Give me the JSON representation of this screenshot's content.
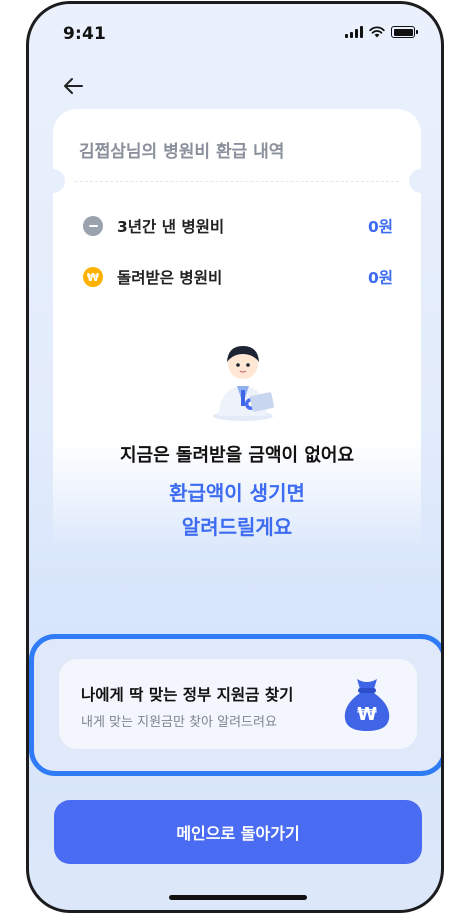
{
  "status_bar": {
    "time": "9:41"
  },
  "card": {
    "title": "김쩝삼님의 병원비 환급 내역",
    "rows": [
      {
        "label": "3년간 낸 병원비",
        "value": "0원",
        "icon": "minus-icon"
      },
      {
        "label": "돌려받은 병원비",
        "value": "0원",
        "icon": "won-coin-icon"
      }
    ],
    "empty_title": "지금은 돌려받을 금액이 없어요",
    "empty_sub_line1": "환급액이 생기면",
    "empty_sub_line2": "알려드릴게요"
  },
  "banner": {
    "title": "나에게 딱 맞는 정부 지원금 찾기",
    "subtitle": "내게 맞는 지원금만 찾아 알려드려요",
    "icon": "money-bag-icon"
  },
  "main_button": {
    "label": "메인으로 돌아가기"
  },
  "colors": {
    "accent": "#4a6cf3",
    "value_blue": "#3d6cf2",
    "highlight": "#2f7cf6",
    "coin": "#ffb100",
    "bag": "#3f64e6"
  }
}
